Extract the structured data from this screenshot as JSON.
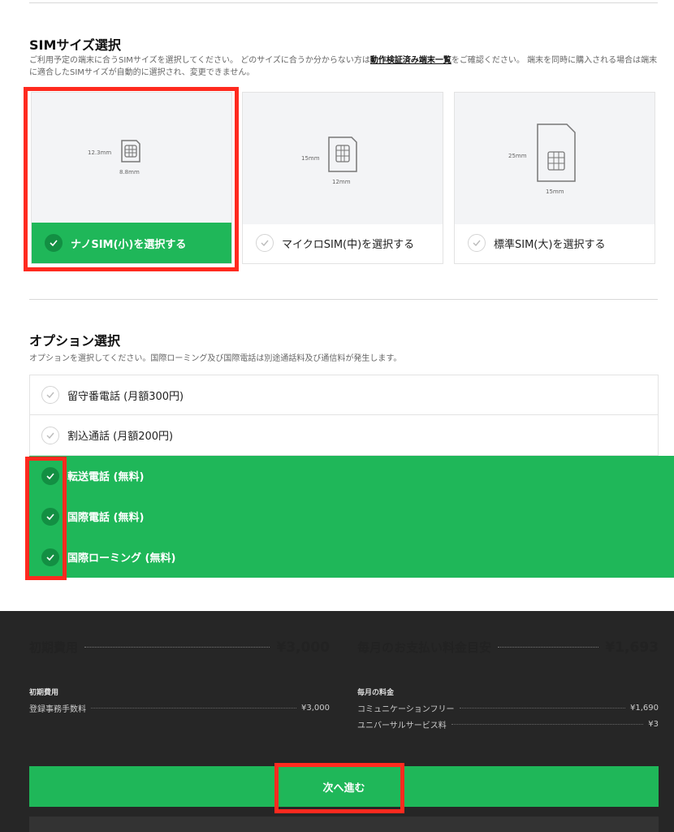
{
  "sim_section": {
    "title": "SIMサイズ選択",
    "desc_before_link": "ご利用予定の端末に合うSIMサイズを選択してください。 どのサイズに合うか分からない方は",
    "desc_link": "動作検証済み端末一覧",
    "desc_after_link": "をご確認ください。 端末を同時に購入される場合は端末に適合したSIMサイズが自動的に選択され、変更できません。",
    "cards": [
      {
        "label": "ナノSIM(小)を選択する",
        "w": "12.3mm",
        "h": "8.8mm",
        "selected": true
      },
      {
        "label": "マイクロSIM(中)を選択する",
        "w": "15mm",
        "h": "12mm",
        "selected": false
      },
      {
        "label": "標準SIM(大)を選択する",
        "w": "25mm",
        "h": "15mm",
        "selected": false
      }
    ]
  },
  "option_section": {
    "title": "オプション選択",
    "desc": "オプションを選択してください。国際ローミング及び国際電話は別途通話料及び通信料が発生します。",
    "options": [
      {
        "label": "留守番電話 (月額300円)",
        "checked": false
      },
      {
        "label": "割込通話 (月額200円)",
        "checked": false
      },
      {
        "label": "転送電話 (無料)",
        "checked": true
      },
      {
        "label": "国際電話 (無料)",
        "checked": true
      },
      {
        "label": "国際ローミング (無料)",
        "checked": true
      }
    ]
  },
  "summary": {
    "initial_label": "初期費用",
    "initial_total": "¥3,000",
    "monthly_label": "毎月のお支払い料金目安",
    "monthly_total": "¥1,693",
    "initial_head": "初期費用",
    "initial_items": [
      {
        "name": "登録事務手数料",
        "price": "¥3,000"
      }
    ],
    "monthly_head": "毎月の料金",
    "monthly_items": [
      {
        "name": "コミュニケーションフリー",
        "price": "¥1,690"
      },
      {
        "name": "ユニバーサルサービス料",
        "price": "¥3"
      }
    ]
  },
  "next_button": "次へ進む",
  "colors": {
    "accent": "#1fb759",
    "highlight": "#ff2a1f",
    "dark_bg": "#262626"
  }
}
